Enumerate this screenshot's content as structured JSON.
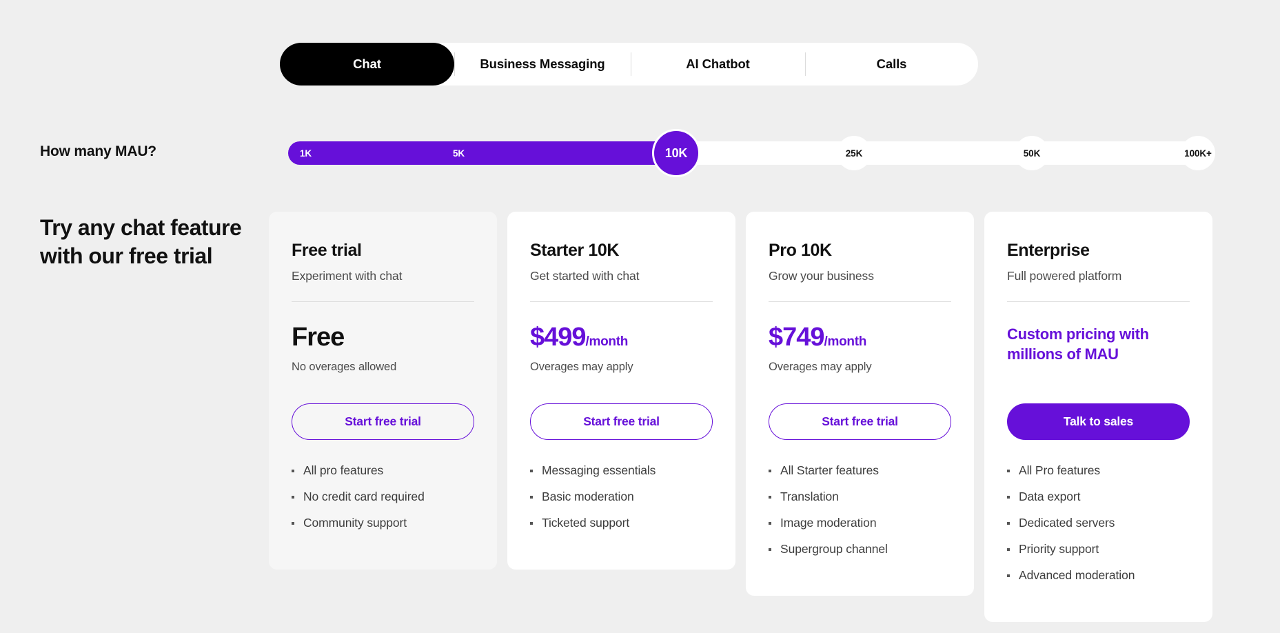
{
  "colors": {
    "page_bg": "#efefef",
    "accent_purple": "#6610d9",
    "active_tab_bg": "#000000",
    "card_bg": "#ffffff",
    "card_bg_tinted": "#f6f6f6",
    "text_primary": "#111111",
    "text_secondary": "#4b4b4b"
  },
  "tabs": {
    "items": [
      {
        "label": "Chat",
        "active": true
      },
      {
        "label": "Business Messaging",
        "active": false
      },
      {
        "label": "AI Chatbot",
        "active": false
      },
      {
        "label": "Calls",
        "active": false
      }
    ]
  },
  "mau": {
    "question": "How many MAU?",
    "selected_value": "10K",
    "stops": [
      {
        "label": "1K",
        "on_fill": true
      },
      {
        "label": "5K",
        "on_fill": true
      },
      {
        "label": "10K",
        "on_fill": true
      },
      {
        "label": "25K",
        "on_fill": false
      },
      {
        "label": "50K",
        "on_fill": false
      },
      {
        "label": "100K+",
        "on_fill": false
      }
    ]
  },
  "headline": "Try any chat feature with our free trial",
  "plans": [
    {
      "title": "Free trial",
      "subtitle": "Experiment with chat",
      "price": "Free",
      "price_period": "",
      "price_accent": false,
      "price_note": "No overages allowed",
      "custom_price": "",
      "cta_label": "Start free trial",
      "cta_style": "outline",
      "tinted": true,
      "features": [
        "All pro features",
        "No credit card required",
        "Community support"
      ]
    },
    {
      "title": "Starter 10K",
      "subtitle": "Get started with chat",
      "price": "$499",
      "price_period": "/month",
      "price_accent": true,
      "price_note": "Overages may apply",
      "custom_price": "",
      "cta_label": "Start free trial",
      "cta_style": "outline",
      "tinted": false,
      "features": [
        "Messaging essentials",
        "Basic moderation",
        "Ticketed support"
      ]
    },
    {
      "title": "Pro 10K",
      "subtitle": "Grow your business",
      "price": "$749",
      "price_period": "/month",
      "price_accent": true,
      "price_note": "Overages may apply",
      "custom_price": "",
      "cta_label": "Start free trial",
      "cta_style": "outline",
      "tinted": false,
      "features": [
        "All Starter features",
        "Translation",
        "Image moderation",
        "Supergroup channel"
      ]
    },
    {
      "title": "Enterprise",
      "subtitle": "Full powered platform",
      "price": "",
      "price_period": "",
      "price_accent": true,
      "price_note": "",
      "custom_price": "Custom pricing with millions of MAU",
      "cta_label": "Talk to sales",
      "cta_style": "solid",
      "tinted": false,
      "features": [
        "All Pro features",
        "Data export",
        "Dedicated servers",
        "Priority support",
        "Advanced moderation"
      ]
    }
  ]
}
